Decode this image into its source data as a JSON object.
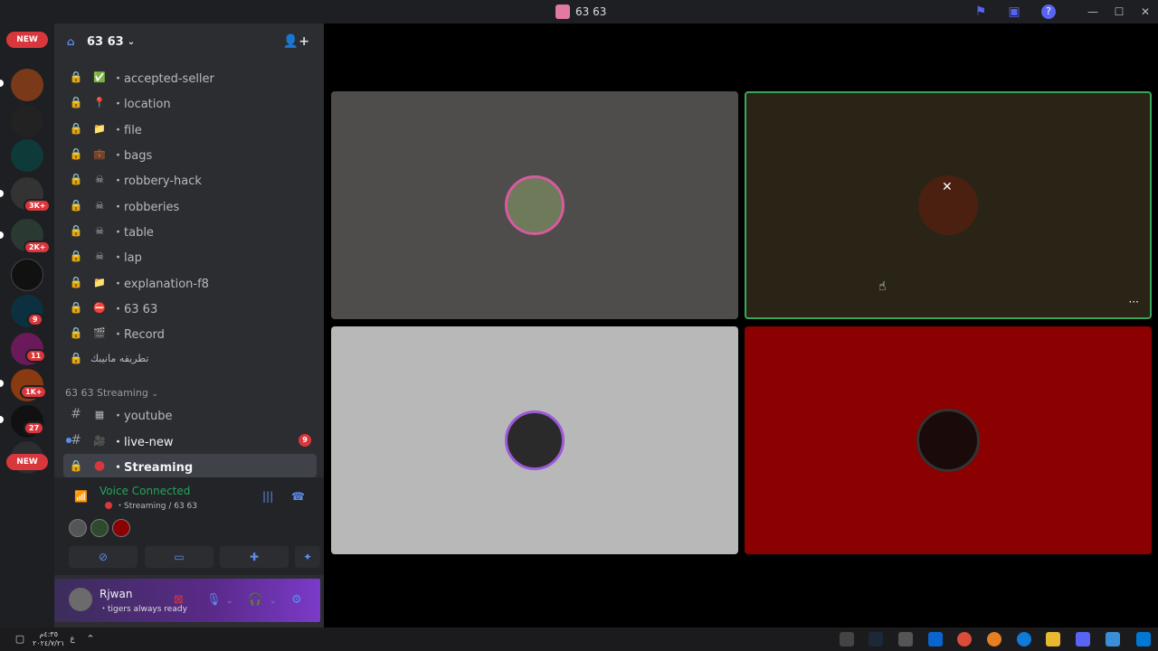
{
  "window": {
    "title": "63 63"
  },
  "guilds": {
    "new_top": "NEW",
    "new_bottom": "NEW",
    "badges": [
      "3K+",
      "2K+",
      "9",
      "11",
      "1K+",
      "27"
    ]
  },
  "server": {
    "name": "63 63"
  },
  "channels": [
    {
      "emoji": "✅",
      "name": "・accepted-seller"
    },
    {
      "emoji": "📍",
      "name": "・location"
    },
    {
      "emoji": "📁",
      "name": "・file"
    },
    {
      "emoji": "💼",
      "name": "・bags"
    },
    {
      "emoji": "☠",
      "name": "・robbery-hack"
    },
    {
      "emoji": "☠",
      "name": "・robberies"
    },
    {
      "emoji": "☠",
      "name": "・table"
    },
    {
      "emoji": "☠",
      "name": "・lap"
    },
    {
      "emoji": "📁",
      "name": "・explanation-f8"
    },
    {
      "emoji": "⛔",
      "name": "・63 63"
    },
    {
      "emoji": "🎬",
      "name": "・Record"
    },
    {
      "emoji": "",
      "name": "تطريقه مانيبك"
    }
  ],
  "category": {
    "label": "63 63 Streaming"
  },
  "stream_channels": [
    {
      "emoji": "▦",
      "name": "・youtube"
    },
    {
      "emoji": "🎥",
      "name": "・live-new",
      "badge": "9"
    },
    {
      "emoji": "●",
      "name": "・Streaming"
    }
  ],
  "voice": {
    "status": "Voice Connected",
    "location": "・Streaming / 63 63"
  },
  "user": {
    "name": "Rjwan",
    "status": "・tigers always ready"
  },
  "taskbar": {
    "time": "٤:٣٥م",
    "date": "٢٠٢٤/٧/٢١",
    "lang": "ع"
  },
  "colors": {
    "accent": "#5865f2",
    "connected": "#23a55a",
    "danger": "#da373c",
    "tile_gray": "#4f4d4b",
    "tile_dark": "#2a2417",
    "tile_light": "#b8b8b8",
    "tile_red": "#8b0000",
    "speaking_border": "#3ba55c"
  }
}
